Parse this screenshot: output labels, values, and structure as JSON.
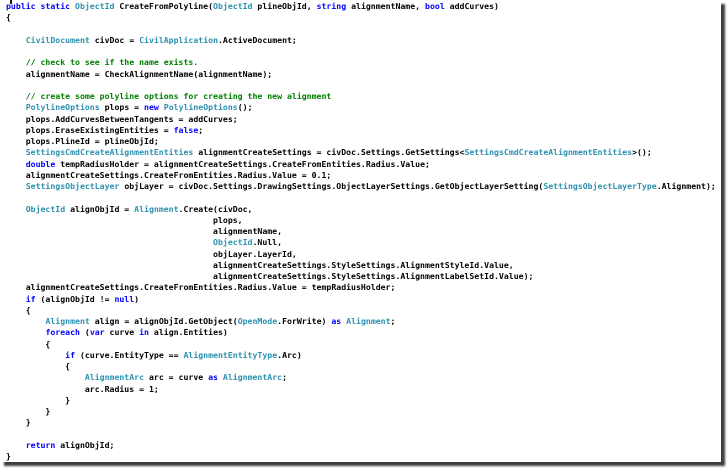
{
  "editor": {
    "language": "csharp",
    "background": "#ffffff",
    "shadow_color": "#3d3d3d",
    "colors": {
      "keyword": "#0000ff",
      "type": "#2b91af",
      "comment": "#008000",
      "plain": "#000000"
    },
    "lines": [
      [
        [
          "k",
          "public static "
        ],
        [
          "t",
          "ObjectId"
        ],
        [
          "p",
          " CreateFromPolyline("
        ],
        [
          "t",
          "ObjectId"
        ],
        [
          "p",
          " plineObjId, "
        ],
        [
          "k",
          "string"
        ],
        [
          "p",
          " alignmentName, "
        ],
        [
          "k",
          "bool"
        ],
        [
          "p",
          " addCurves)"
        ]
      ],
      [
        [
          "p",
          "{"
        ]
      ],
      [],
      [
        [
          "p",
          "    "
        ],
        [
          "t",
          "CivilDocument"
        ],
        [
          "p",
          " civDoc = "
        ],
        [
          "t",
          "CivilApplication"
        ],
        [
          "p",
          ".ActiveDocument;"
        ]
      ],
      [],
      [
        [
          "c",
          "    // check to see if the name exists."
        ]
      ],
      [
        [
          "p",
          "    alignmentName = CheckAlignmentName(alignmentName);"
        ]
      ],
      [],
      [
        [
          "c",
          "    // create some polyline options for creating the new alignment"
        ]
      ],
      [
        [
          "p",
          "    "
        ],
        [
          "t",
          "PolylineOptions"
        ],
        [
          "p",
          " plops = "
        ],
        [
          "k",
          "new"
        ],
        [
          "p",
          " "
        ],
        [
          "t",
          "PolylineOptions"
        ],
        [
          "p",
          "();"
        ]
      ],
      [
        [
          "p",
          "    plops.AddCurvesBetweenTangents = addCurves;"
        ]
      ],
      [
        [
          "p",
          "    plops.EraseExistingEntities = "
        ],
        [
          "k",
          "false"
        ],
        [
          "p",
          ";"
        ]
      ],
      [
        [
          "p",
          "    plops.PlineId = plineObjId;"
        ]
      ],
      [
        [
          "p",
          "    "
        ],
        [
          "t",
          "SettingsCmdCreateAlignmentEntities"
        ],
        [
          "p",
          " alignmentCreateSettings = civDoc.Settings.GetSettings<"
        ],
        [
          "t",
          "SettingsCmdCreateAlignmentEntities"
        ],
        [
          "p",
          ">();"
        ]
      ],
      [
        [
          "p",
          "    "
        ],
        [
          "k",
          "double"
        ],
        [
          "p",
          " tempRadiusHolder = alignmentCreateSettings.CreateFromEntities.Radius.Value;"
        ]
      ],
      [
        [
          "p",
          "    alignmentCreateSettings.CreateFromEntities.Radius.Value = 0.1;"
        ]
      ],
      [
        [
          "p",
          "    "
        ],
        [
          "t",
          "SettingsObjectLayer"
        ],
        [
          "p",
          " objLayer = civDoc.Settings.DrawingSettings.ObjectLayerSettings.GetObjectLayerSetting("
        ],
        [
          "t",
          "SettingsObjectLayerType"
        ],
        [
          "p",
          ".Alignment);"
        ]
      ],
      [],
      [
        [
          "p",
          "    "
        ],
        [
          "t",
          "ObjectId"
        ],
        [
          "p",
          " alignObjId = "
        ],
        [
          "t",
          "Alignment"
        ],
        [
          "p",
          ".Create(civDoc,"
        ]
      ],
      [
        [
          "p",
          "                                          plops,"
        ]
      ],
      [
        [
          "p",
          "                                          alignmentName,"
        ]
      ],
      [
        [
          "p",
          "                                          "
        ],
        [
          "t",
          "ObjectId"
        ],
        [
          "p",
          ".Null,"
        ]
      ],
      [
        [
          "p",
          "                                          objLayer.LayerId,"
        ]
      ],
      [
        [
          "p",
          "                                          alignmentCreateSettings.StyleSettings.AlignmentStyleId.Value,"
        ]
      ],
      [
        [
          "p",
          "                                          alignmentCreateSettings.StyleSettings.AlignmentLabelSetId.Value);"
        ]
      ],
      [
        [
          "p",
          "    alignmentCreateSettings.CreateFromEntities.Radius.Value = tempRadiusHolder;"
        ]
      ],
      [
        [
          "p",
          "    "
        ],
        [
          "k",
          "if"
        ],
        [
          "p",
          " (alignObjId != "
        ],
        [
          "k",
          "null"
        ],
        [
          "p",
          ")"
        ]
      ],
      [
        [
          "p",
          "    {"
        ]
      ],
      [
        [
          "p",
          "        "
        ],
        [
          "t",
          "Alignment"
        ],
        [
          "p",
          " align = alignObjId.GetObject("
        ],
        [
          "t",
          "OpenMode"
        ],
        [
          "p",
          ".ForWrite) "
        ],
        [
          "k",
          "as"
        ],
        [
          "p",
          " "
        ],
        [
          "t",
          "Alignment"
        ],
        [
          "p",
          ";"
        ]
      ],
      [
        [
          "p",
          "        "
        ],
        [
          "k",
          "foreach"
        ],
        [
          "p",
          " ("
        ],
        [
          "k",
          "var"
        ],
        [
          "p",
          " curve "
        ],
        [
          "k",
          "in"
        ],
        [
          "p",
          " align.Entities)"
        ]
      ],
      [
        [
          "p",
          "        {"
        ]
      ],
      [
        [
          "p",
          "            "
        ],
        [
          "k",
          "if"
        ],
        [
          "p",
          " (curve.EntityType == "
        ],
        [
          "t",
          "AlignmentEntityType"
        ],
        [
          "p",
          ".Arc)"
        ]
      ],
      [
        [
          "p",
          "            {"
        ]
      ],
      [
        [
          "p",
          "                "
        ],
        [
          "t",
          "AlignmentArc"
        ],
        [
          "p",
          " arc = curve "
        ],
        [
          "k",
          "as"
        ],
        [
          "p",
          " "
        ],
        [
          "t",
          "AlignmentArc"
        ],
        [
          "p",
          ";"
        ]
      ],
      [
        [
          "p",
          "                arc.Radius = 1;"
        ]
      ],
      [
        [
          "p",
          "            }"
        ]
      ],
      [
        [
          "p",
          "        }"
        ]
      ],
      [
        [
          "p",
          "    }"
        ]
      ],
      [],
      [
        [
          "p",
          "    "
        ],
        [
          "k",
          "return"
        ],
        [
          "p",
          " alignObjId;"
        ]
      ],
      [
        [
          "p",
          "}"
        ]
      ]
    ]
  }
}
